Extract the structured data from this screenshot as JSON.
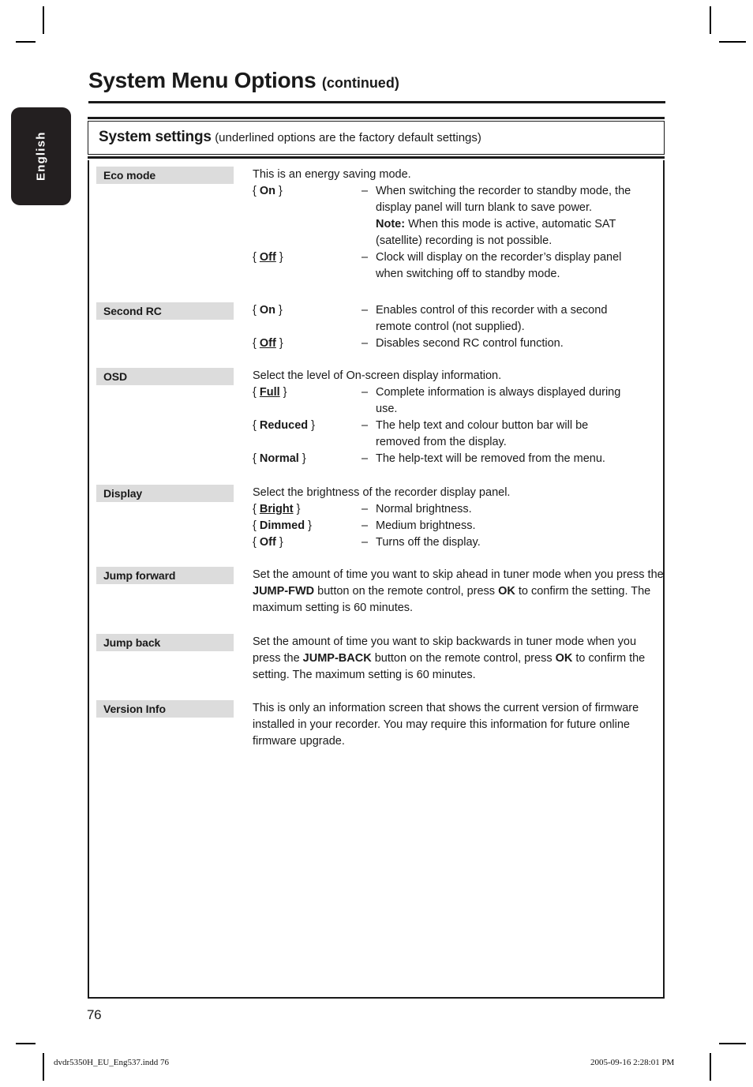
{
  "page": {
    "title": "System Menu Options",
    "title_suffix": "(continued)",
    "language_tab": "English",
    "page_number": "76"
  },
  "settings_header": {
    "title": "System settings",
    "note": "(underlined options are the factory default settings)"
  },
  "rows": [
    {
      "label": "Eco mode",
      "intro": "This is an energy saving mode.",
      "options": [
        {
          "open": "{ ",
          "value": "On",
          "underlined": false,
          "close": " }",
          "dash": "–",
          "desc_lines": [
            "When switching the recorder to standby mode, the",
            "display panel will turn blank to save power."
          ],
          "note_label": "Note:",
          "note_lines": [
            " When this mode is active, automatic SAT",
            "(satellite) recording is not possible."
          ]
        },
        {
          "open": "{ ",
          "value": "Off",
          "underlined": true,
          "close": " }",
          "dash": "–",
          "desc_lines": [
            "Clock will display on the recorder’s display panel",
            "when switching off to standby mode."
          ]
        }
      ]
    },
    {
      "label": "Second RC",
      "intro": "",
      "options": [
        {
          "open": "{ ",
          "value": "On",
          "underlined": false,
          "close": " }",
          "dash": "–",
          "desc_lines": [
            "Enables control of this recorder with a second",
            "remote control (not supplied)."
          ]
        },
        {
          "open": "{ ",
          "value": "Off",
          "underlined": true,
          "close": " }",
          "dash": "–",
          "desc_lines": [
            "Disables second RC control function."
          ]
        }
      ]
    },
    {
      "label": "OSD",
      "intro": "Select the level of On-screen display information.",
      "options": [
        {
          "open": "{ ",
          "value": "Full",
          "underlined": true,
          "close": " }",
          "dash": "–",
          "desc_lines": [
            "Complete information is always displayed during",
            "use."
          ]
        },
        {
          "open": "{ ",
          "value": "Reduced",
          "underlined": false,
          "close": " }",
          "dash": "–",
          "desc_lines": [
            "The help text and colour button bar will be",
            "removed from the display."
          ]
        },
        {
          "open": "{ ",
          "value": "Normal",
          "underlined": false,
          "close": " }",
          "dash": "–",
          "desc_lines": [
            "The help-text will be removed from the menu."
          ]
        }
      ]
    },
    {
      "label": "Display",
      "intro": "Select the brightness of the recorder display panel.",
      "options": [
        {
          "open": "{ ",
          "value": "Bright",
          "underlined": true,
          "close": " }",
          "dash": "–",
          "desc_lines": [
            "Normal brightness."
          ]
        },
        {
          "open": "{ ",
          "value": "Dimmed",
          "underlined": false,
          "close": " }",
          "dash": "–",
          "desc_lines": [
            "Medium brightness."
          ]
        },
        {
          "open": "{ ",
          "value": "Off",
          "underlined": false,
          "close": " }",
          "dash": "–",
          "desc_lines": [
            "Turns off the display."
          ]
        }
      ]
    },
    {
      "label": "Jump forward",
      "paragraph": {
        "part1": "Set the amount of time you want to skip ahead in tuner mode when you press the ",
        "bold1": "JUMP-FWD",
        "part2": " button on the remote control, press ",
        "bold2": "OK",
        "part3": " to confirm the setting. The maximum setting is 60 minutes."
      }
    },
    {
      "label": "Jump back",
      "paragraph": {
        "part1": "Set the amount of time you want to skip backwards in tuner mode when you press the ",
        "bold1": "JUMP-BACK",
        "part2": " button on the remote control, press ",
        "bold2": "OK",
        "part3": " to confirm the setting. The maximum setting is 60 minutes."
      }
    },
    {
      "label": "Version Info",
      "paragraph": {
        "part1": "This is only an information screen that shows the current version of firmware installed in your recorder. You may require this information for future online firmware upgrade.",
        "bold1": "",
        "part2": "",
        "bold2": "",
        "part3": ""
      }
    }
  ],
  "footer": {
    "left": "dvdr5350H_EU_Eng537.indd   76",
    "right": "2005-09-16   2:28:01 PM"
  }
}
